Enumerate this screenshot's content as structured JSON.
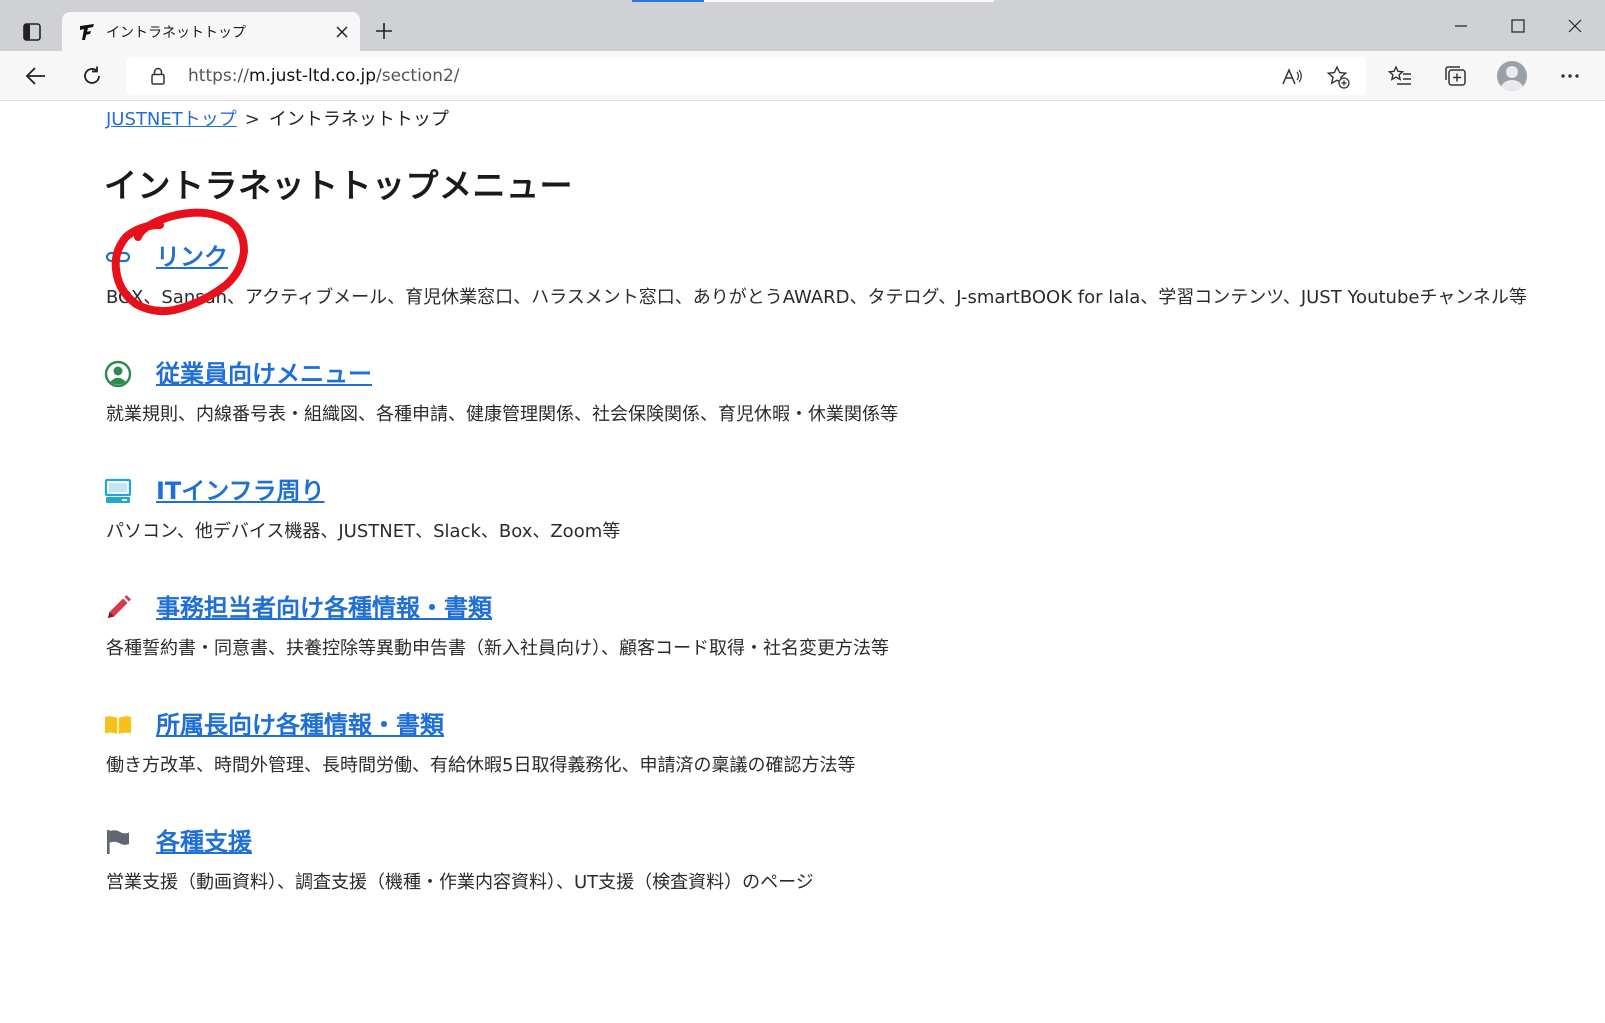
{
  "browser": {
    "tab": {
      "title": "イントラネットトップ",
      "favicon": "justsystems-logo-icon"
    },
    "address": {
      "scheme": "https://",
      "host": "m.just-ltd.co.jp",
      "path": "/section2/"
    }
  },
  "breadcrumb": {
    "home": "JUSTNETトップ",
    "separator": ">",
    "current": "イントラネットトップ"
  },
  "page_title": "イントラネットトップメニュー",
  "sections": [
    {
      "icon": "link-icon",
      "color": "#1f6fd6",
      "title": "リンク",
      "desc": "BOX、Sansan、アクティブメール、育児休業窓口、ハラスメント窓口、ありがとうAWARD、タテログ、J-smartBOOK for lala、学習コンテンツ、JUST Youtubeチャンネル等"
    },
    {
      "icon": "user-circle-icon",
      "color": "#2f8a4e",
      "title": "従業員向けメニュー",
      "desc": "就業規則、内線番号表・組織図、各種申請、健康管理関係、社会保険関係、育児休暇・休業関係等"
    },
    {
      "icon": "computer-icon",
      "color": "#22a6d8",
      "title": "ITインフラ周り",
      "desc": "パソコン、他デバイス機器、JUSTNET、Slack、Box、Zoom等"
    },
    {
      "icon": "pencil-icon",
      "color": "#d93a48",
      "title": "事務担当者向け各種情報・書類",
      "desc": "各種誓約書・同意書、扶養控除等異動申告書（新入社員向け）、顧客コード取得・社名変更方法等"
    },
    {
      "icon": "book-icon",
      "color": "#f4c21a",
      "title": "所属長向け各種情報・書類",
      "desc": "働き方改革、時間外管理、長時間労働、有給休暇5日取得義務化、申請済の稟議の確認方法等"
    },
    {
      "icon": "flag-icon",
      "color": "#5f6670",
      "title": "各種支援",
      "desc": "営業支援（動画資料）、調査支援（機種・作業内容資料）、UT支援（検査資料）のページ"
    }
  ],
  "annotation": {
    "shape": "hand-drawn-circle",
    "color": "#e8101a"
  }
}
